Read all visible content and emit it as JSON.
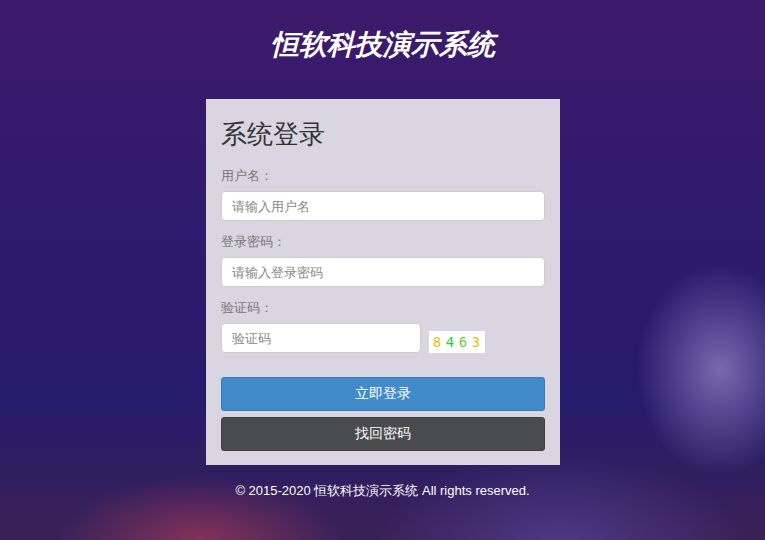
{
  "title": "恒软科技演示系统",
  "login": {
    "heading": "系统登录",
    "fields": [
      {
        "label": "用户名：",
        "placeholder": "请输入用户名",
        "kind": "text"
      },
      {
        "label": "登录密码：",
        "placeholder": "请输入登录密码",
        "kind": "password"
      },
      {
        "label": "验证码：",
        "placeholder": "验证码",
        "kind": "captcha"
      }
    ],
    "captcha": [
      {
        "char": "8",
        "color": "#e8c21a"
      },
      {
        "char": "4",
        "color": "#1fcf4a"
      },
      {
        "char": "6",
        "color": "#6fcf2a"
      },
      {
        "char": "3",
        "color": "#e0c41a"
      }
    ],
    "buttons": [
      {
        "label": "立即登录",
        "kind": "primary"
      },
      {
        "label": "找回密码",
        "kind": "secondary"
      }
    ]
  },
  "footer": "© 2015-2020 恒软科技演示系统 All rights reserved."
}
